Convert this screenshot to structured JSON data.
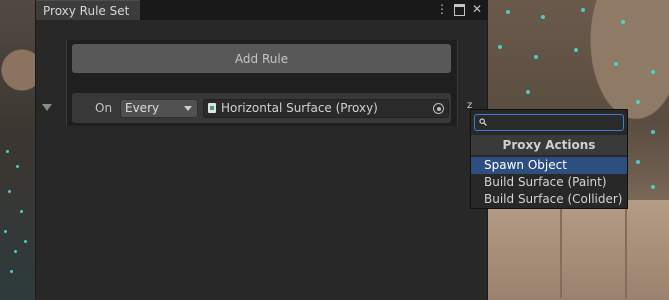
{
  "window": {
    "tab_title": "Proxy Rule Set",
    "more_icon": "more-vertical-icon",
    "maximize_icon": "maximize-icon",
    "close_icon": "close-icon"
  },
  "ruleset": {
    "add_rule_label": "Add Rule",
    "rule": {
      "on_label": "On",
      "frequency": "Every",
      "target_object": "Horizontal Surface (Proxy)"
    },
    "edge_marker": "z"
  },
  "proxy_actions_popup": {
    "search_value": "",
    "title": "Proxy Actions",
    "items": [
      {
        "label": "Spawn Object",
        "selected": true
      },
      {
        "label": "Build Surface (Paint)",
        "selected": false
      },
      {
        "label": "Build Surface (Collider)",
        "selected": false
      }
    ]
  },
  "colors": {
    "selection": "#2d4f80",
    "search_focus": "#3c7fd1",
    "scene_dots": "#49d8d0"
  }
}
